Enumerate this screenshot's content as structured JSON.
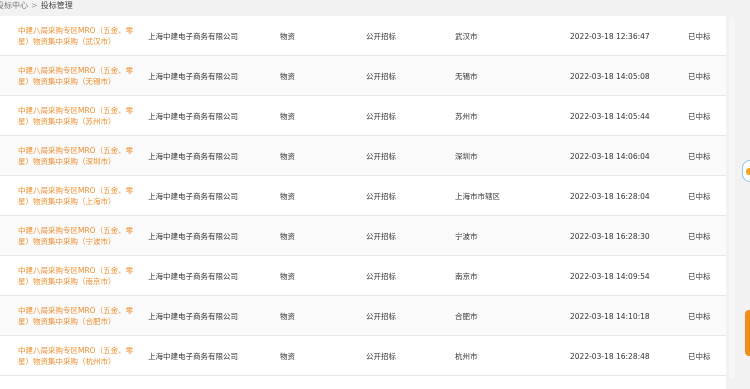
{
  "breadcrumb": {
    "parent": "投标中心",
    "separator": ">",
    "current": "投标管理"
  },
  "colors": {
    "link": "#f08c2a",
    "accent_tab": "#f28c1e"
  },
  "rows": [
    {
      "name": "中建八局采购专区MRO（五金、零星）物资集中采购（武汉市）",
      "company": "上海中建电子商务有限公司",
      "category": "物资",
      "method": "公开招标",
      "city": "武汉市",
      "time": "2022-03-18 12:36:47",
      "status": "已中标"
    },
    {
      "name": "中建八局采购专区MRO（五金、零星）物资集中采购（无锡市）",
      "company": "上海中建电子商务有限公司",
      "category": "物资",
      "method": "公开招标",
      "city": "无锡市",
      "time": "2022-03-18 14:05:08",
      "status": "已中标"
    },
    {
      "name": "中建八局采购专区MRO（五金、零星）物资集中采购（苏州市）",
      "company": "上海中建电子商务有限公司",
      "category": "物资",
      "method": "公开招标",
      "city": "苏州市",
      "time": "2022-03-18 14:05:44",
      "status": "已中标"
    },
    {
      "name": "中建八局采购专区MRO（五金、零星）物资集中采购（深圳市）",
      "company": "上海中建电子商务有限公司",
      "category": "物资",
      "method": "公开招标",
      "city": "深圳市",
      "time": "2022-03-18 14:06:04",
      "status": "已中标"
    },
    {
      "name": "中建八局采购专区MRO（五金、零星）物资集中采购（上海市）",
      "company": "上海中建电子商务有限公司",
      "category": "物资",
      "method": "公开招标",
      "city": "上海市市辖区",
      "time": "2022-03-18 16:28:04",
      "status": "已中标"
    },
    {
      "name": "中建八局采购专区MRO（五金、零星）物资集中采购（宁波市）",
      "company": "上海中建电子商务有限公司",
      "category": "物资",
      "method": "公开招标",
      "city": "宁波市",
      "time": "2022-03-18 16:28:30",
      "status": "已中标"
    },
    {
      "name": "中建八局采购专区MRO（五金、零星）物资集中采购（南京市）",
      "company": "上海中建电子商务有限公司",
      "category": "物资",
      "method": "公开招标",
      "city": "南京市",
      "time": "2022-03-18 14:09:54",
      "status": "已中标"
    },
    {
      "name": "中建八局采购专区MRO（五金、零星）物资集中采购（合肥市）",
      "company": "上海中建电子商务有限公司",
      "category": "物资",
      "method": "公开招标",
      "city": "合肥市",
      "time": "2022-03-18 14:10:18",
      "status": "已中标"
    },
    {
      "name": "中建八局采购专区MRO（五金、零星）物资集中采购（杭州市）",
      "company": "上海中建电子商务有限公司",
      "category": "物资",
      "method": "公开招标",
      "city": "杭州市",
      "time": "2022-03-18 16:28:48",
      "status": "已中标"
    }
  ]
}
